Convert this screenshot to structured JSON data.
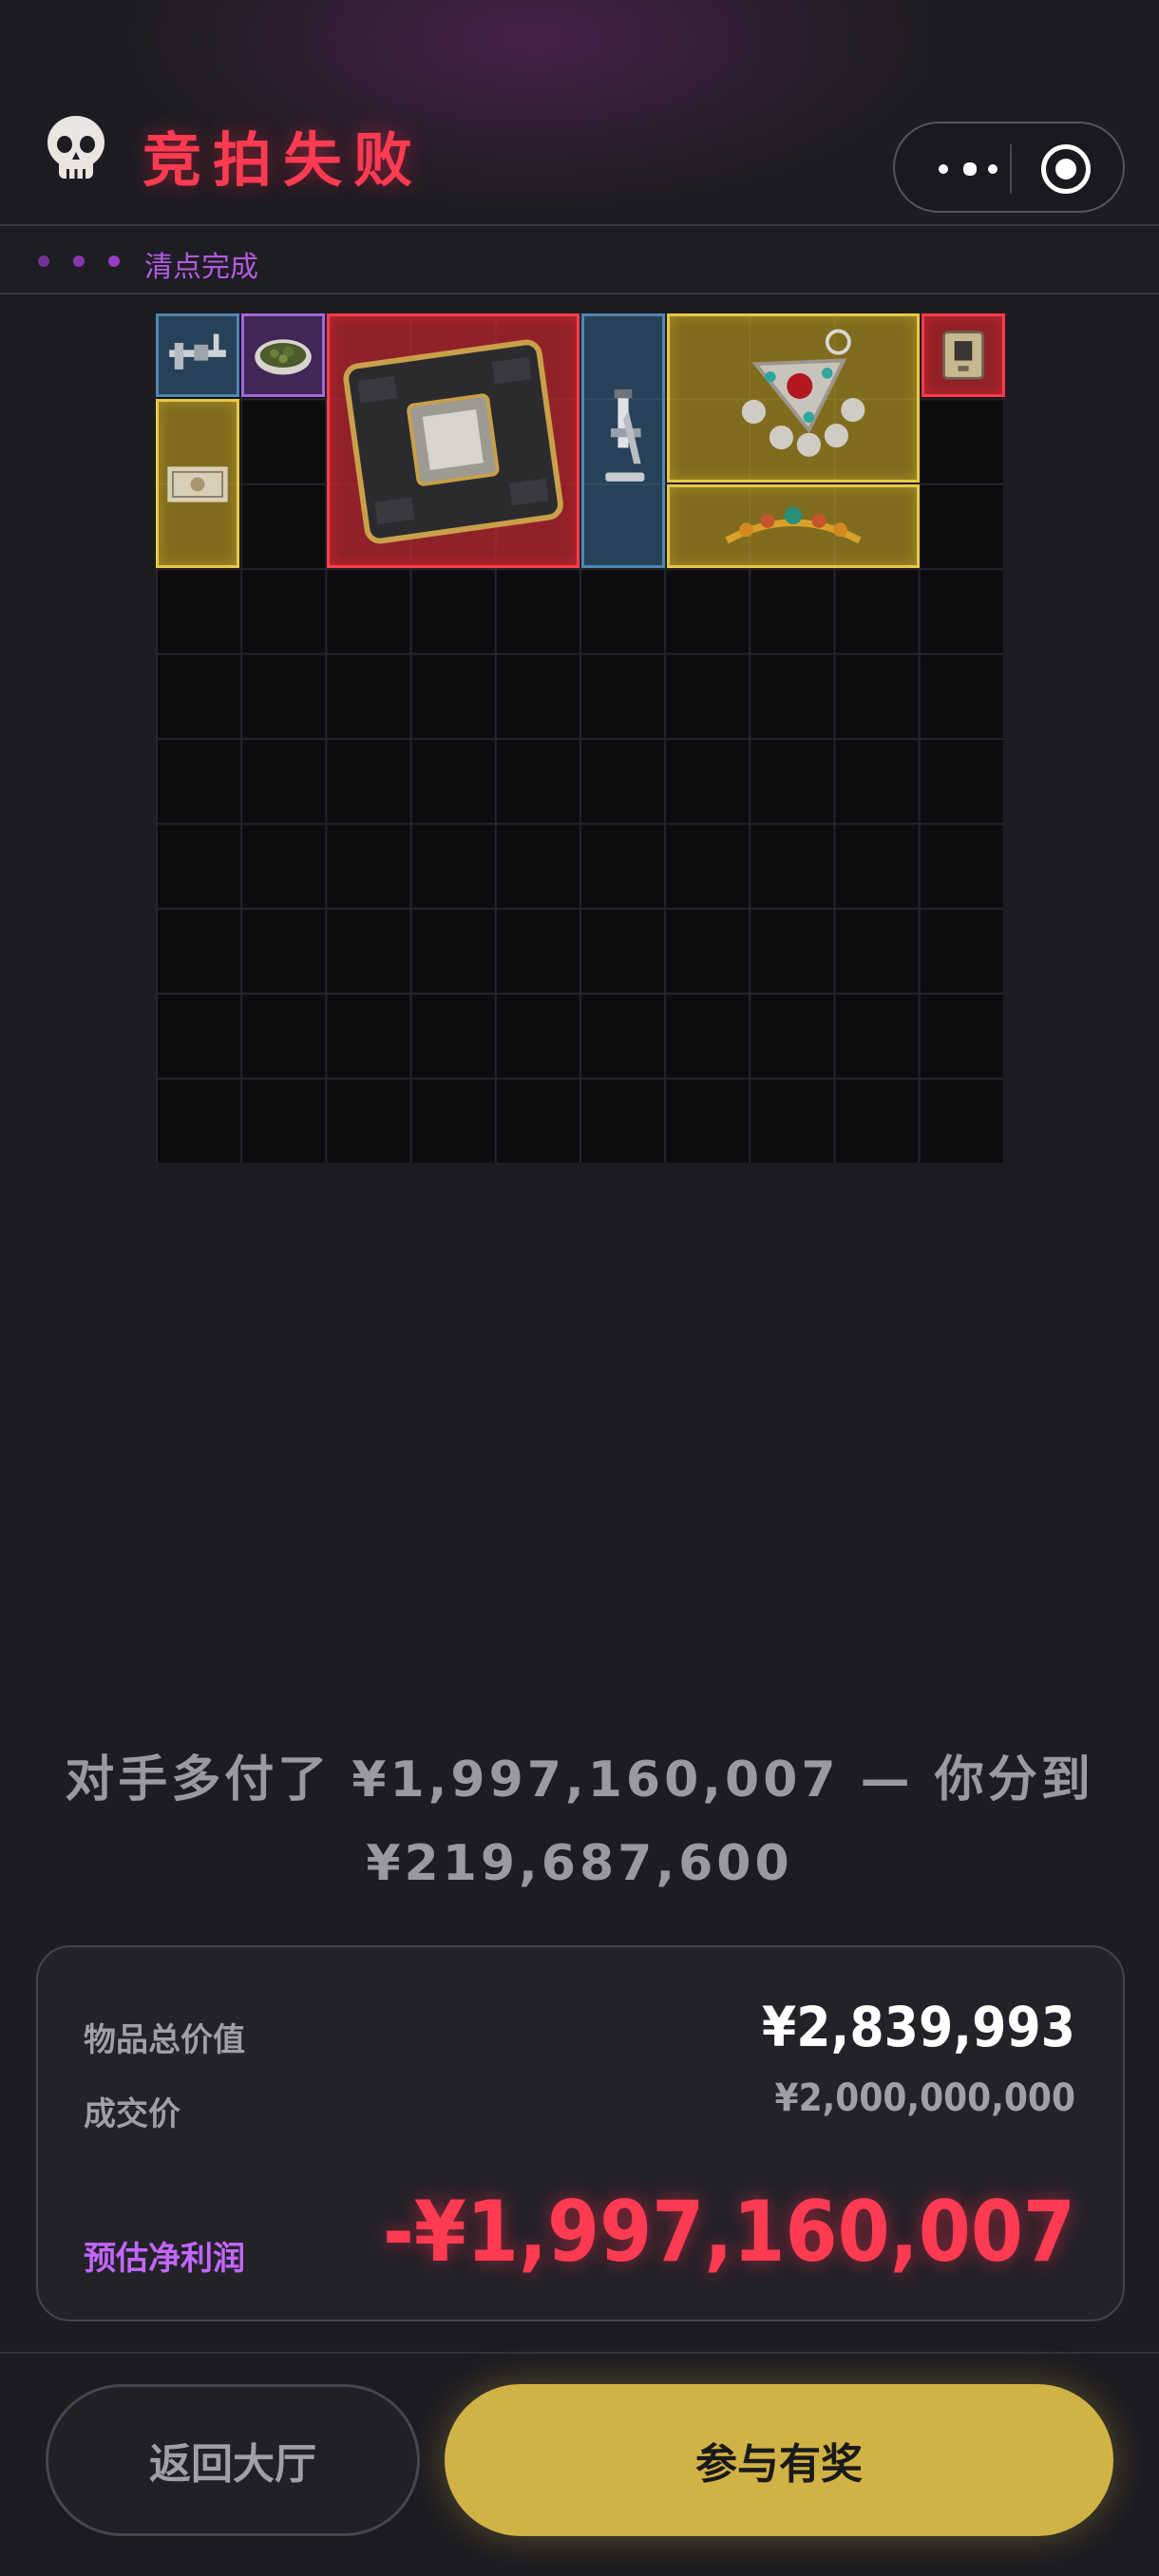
{
  "header": {
    "title": "竞拍失败",
    "skull_icon": "skull-icon",
    "more_icon": "more-dots-icon",
    "close_icon": "target-circle-icon"
  },
  "status": {
    "text": "清点完成"
  },
  "grid": {
    "columns": 10,
    "rows": 10,
    "items": [
      {
        "name": "caliper",
        "rarity": "blue",
        "icon": "caliper-icon"
      },
      {
        "name": "herb-dish",
        "rarity": "purple",
        "icon": "herb-dish-icon"
      },
      {
        "name": "gpu-chip",
        "rarity": "red",
        "icon": "chip-icon"
      },
      {
        "name": "microscope",
        "rarity": "blue",
        "icon": "microscope-icon"
      },
      {
        "name": "pendant",
        "rarity": "gold",
        "icon": "pendant-icon"
      },
      {
        "name": "device",
        "rarity": "red",
        "icon": "device-icon"
      },
      {
        "name": "banknote",
        "rarity": "gold",
        "icon": "banknote-icon"
      },
      {
        "name": "tiara",
        "rarity": "gold",
        "icon": "tiara-icon"
      }
    ]
  },
  "summary": {
    "line1": "对手多付了 ¥1,997,160,007 — 你分到",
    "line2": "¥219,687,600"
  },
  "stats": {
    "total_value_label": "物品总价值",
    "total_value": "¥2,839,993",
    "deal_price_label": "成交价",
    "deal_price": "¥2,000,000,000",
    "profit_label": "预估净利润",
    "profit": "-¥1,997,160,007"
  },
  "footer": {
    "back_label": "返回大厅",
    "join_label": "参与有奖"
  },
  "colors": {
    "title_red": "#ff3b52",
    "accent_purple": "#b25be0",
    "gold_button": "#d1b245"
  }
}
